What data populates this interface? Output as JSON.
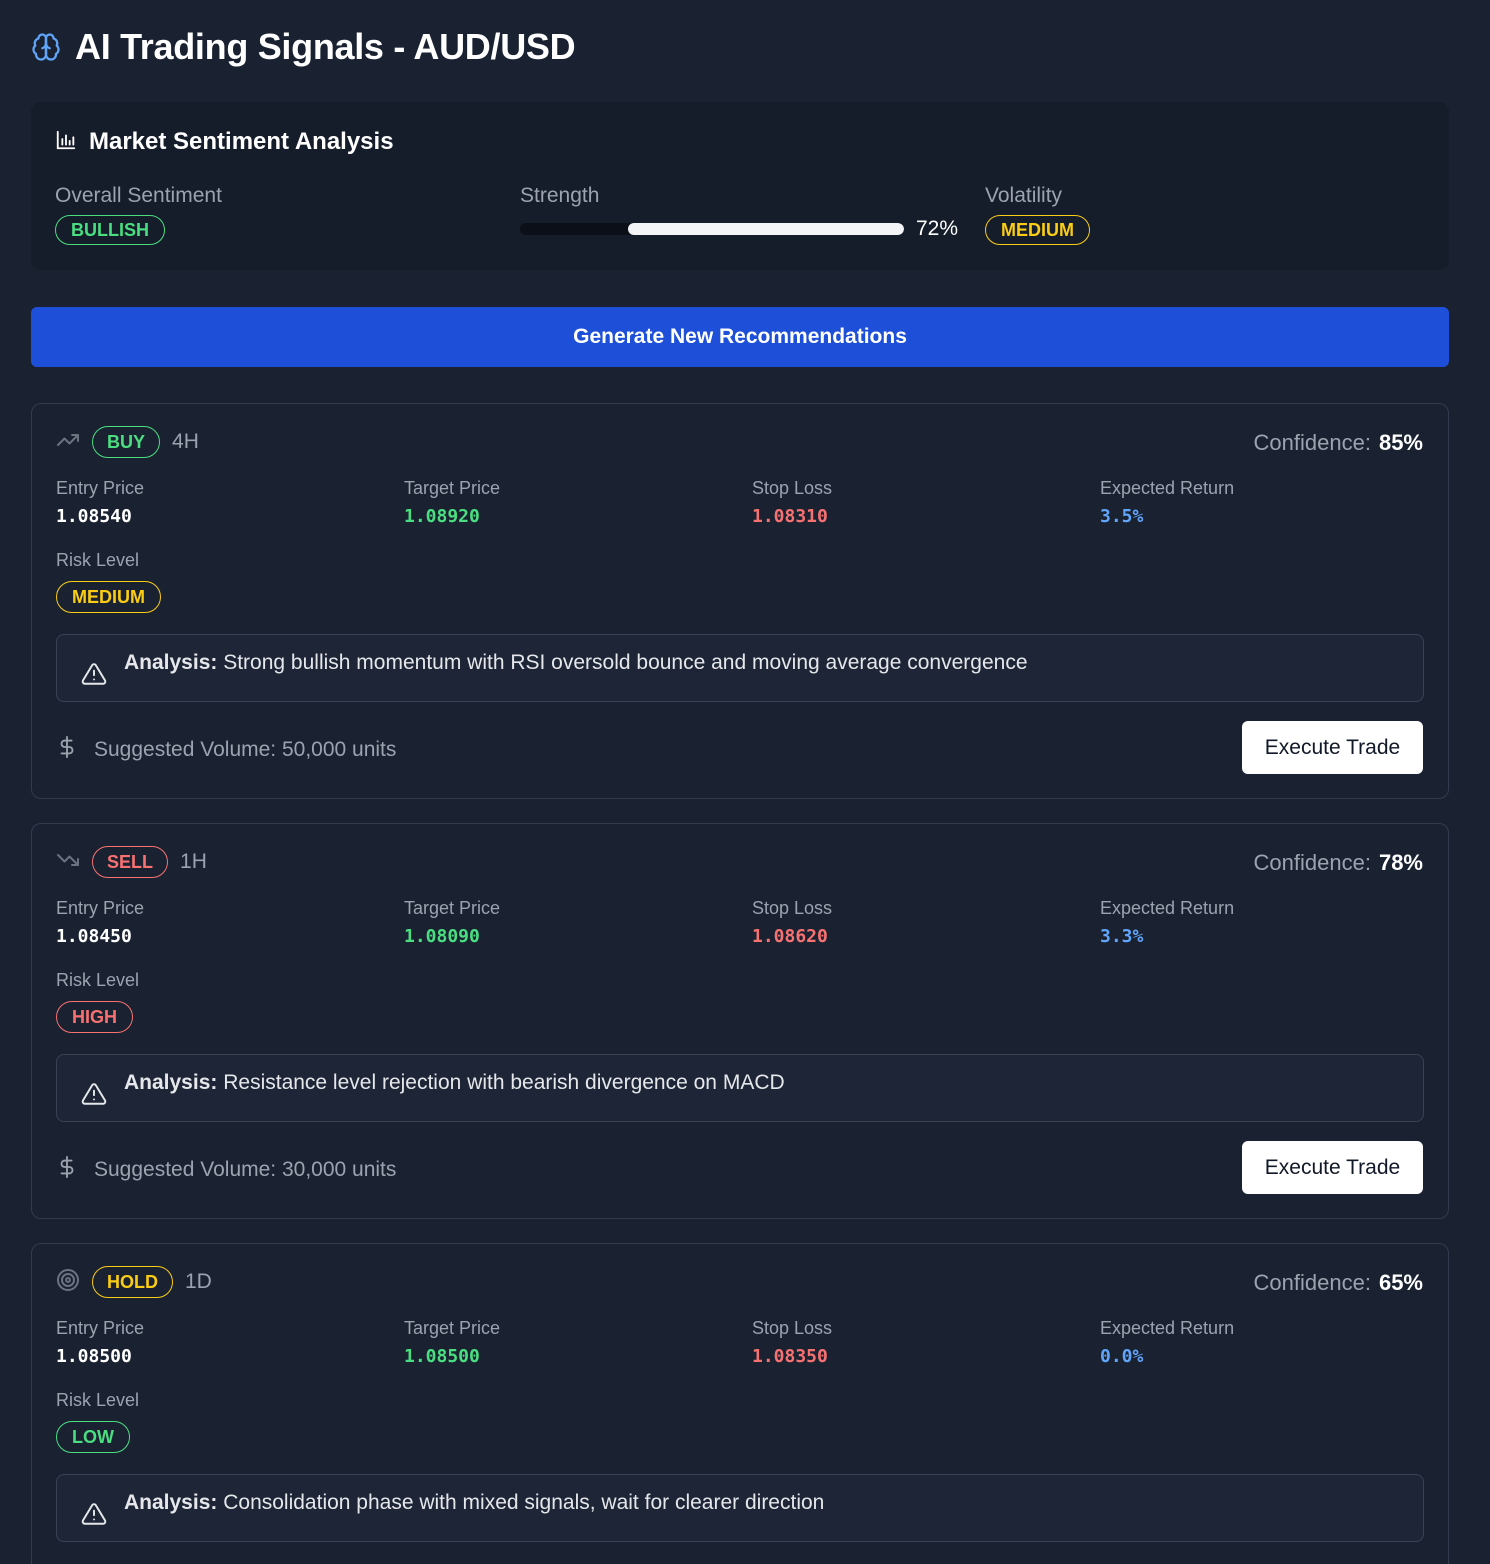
{
  "header": {
    "title": "AI Trading Signals - AUD/USD",
    "icon": "brain-icon",
    "icon_color": "#60a5fa"
  },
  "sentiment": {
    "title": "Market Sentiment Analysis",
    "icon": "bar-chart-icon",
    "overall_label": "Overall Sentiment",
    "overall_value": "BULLISH",
    "strength_label": "Strength",
    "strength_value": "72%",
    "strength_fraction": 0.72,
    "volatility_label": "Volatility",
    "volatility_value": "MEDIUM"
  },
  "generate_button": {
    "label": "Generate New Recommendations",
    "color": "#1e4fd8"
  },
  "labels": {
    "confidence": "Confidence:",
    "entry": "Entry Price",
    "target": "Target Price",
    "stop": "Stop Loss",
    "expected": "Expected Return",
    "risk": "Risk Level",
    "analysis": "Analysis:",
    "execute": "Execute Trade"
  },
  "signals": [
    {
      "action": "BUY",
      "action_icon": "trending-up-icon",
      "timeframe": "4H",
      "confidence": "85%",
      "entry": "1.08540",
      "target": "1.08920",
      "stop": "1.08310",
      "expected": "3.5%",
      "risk": "MEDIUM",
      "analysis": "Strong bullish momentum with RSI oversold bounce and moving average convergence",
      "volume": "Suggested Volume: 50,000 units"
    },
    {
      "action": "SELL",
      "action_icon": "trending-down-icon",
      "timeframe": "1H",
      "confidence": "78%",
      "entry": "1.08450",
      "target": "1.08090",
      "stop": "1.08620",
      "expected": "3.3%",
      "risk": "HIGH",
      "analysis": "Resistance level rejection with bearish divergence on MACD",
      "volume": "Suggested Volume: 30,000 units"
    },
    {
      "action": "HOLD",
      "action_icon": "target-icon",
      "timeframe": "1D",
      "confidence": "65%",
      "entry": "1.08500",
      "target": "1.08500",
      "stop": "1.08350",
      "expected": "0.0%",
      "risk": "LOW",
      "analysis": "Consolidation phase with mixed signals, wait for clearer direction",
      "volume": ""
    }
  ],
  "colors": {
    "background": "#1a2232",
    "positive": "#4ade80",
    "negative": "#f87171",
    "warning": "#facc15",
    "info": "#60a5fa"
  }
}
